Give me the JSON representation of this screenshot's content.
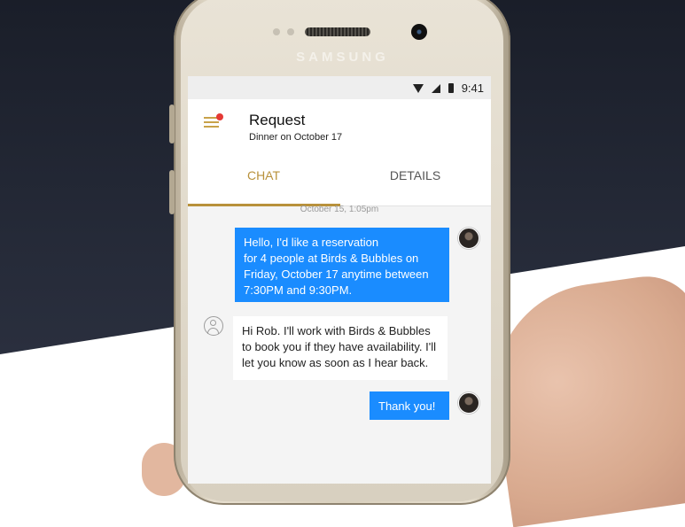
{
  "device": {
    "brand": "SAMSUNG"
  },
  "status_bar": {
    "time": "9:41"
  },
  "app_bar": {
    "title": "Request",
    "subtitle": "Dinner on October 17",
    "menu_icon": "hamburger-menu-icon",
    "notification_dot_color": "#e53935"
  },
  "tabs": [
    {
      "label": "CHAT",
      "active": true
    },
    {
      "label": "DETAILS",
      "active": false
    }
  ],
  "chat": {
    "timestamp": "October 15, 1:05pm",
    "messages": [
      {
        "sender": "user",
        "lines": [
          "Hello, I'd like a reservation",
          "for 4 people at Birds & Bubbles on",
          "Friday, October 17 anytime between",
          "7:30PM and 9:30PM."
        ]
      },
      {
        "sender": "assistant",
        "lines": [
          "Hi Rob. I'll work with Birds & Bubbles",
          "to book you if they have availability. I'll",
          "let you know as soon as I hear back."
        ]
      },
      {
        "sender": "user",
        "lines": [
          "Thank you!"
        ]
      }
    ]
  },
  "colors": {
    "accent": "#b8913b",
    "user_bubble": "#1a8cff",
    "assistant_bubble": "#ffffff"
  }
}
